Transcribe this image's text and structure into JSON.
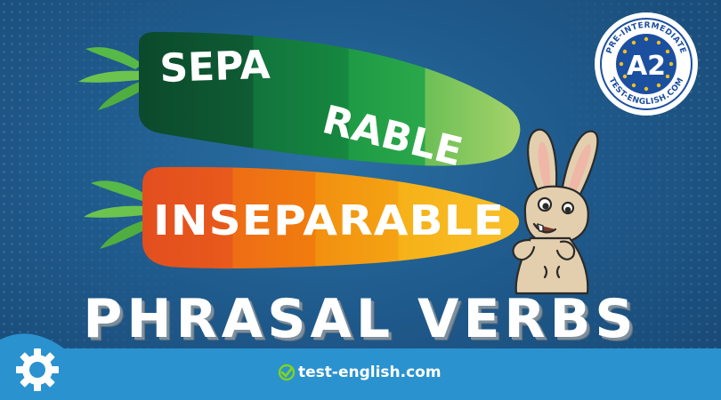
{
  "banner": {
    "carrot_top_words": [
      "SEPA",
      "RABLE"
    ],
    "carrot_bottom_word": "INSEPARABLE",
    "title": "PHRASAL VERBS",
    "site": "test-english.com"
  },
  "badge": {
    "level": "A2",
    "top_text": "PRE-INTERMEDIATE",
    "bottom_text": "TEST-ENGLISH.COM"
  },
  "icons": [
    "check-icon",
    "gear-icon",
    "star-icon",
    "rabbit-illustration"
  ],
  "colors": {
    "background": "#1f5a8c",
    "footer": "#2a92cf",
    "green_dark": "#0d4f2f",
    "orange": "#f07d0e",
    "badge_blue": "#1b4fa0",
    "badge_star": "#f2c21b"
  }
}
